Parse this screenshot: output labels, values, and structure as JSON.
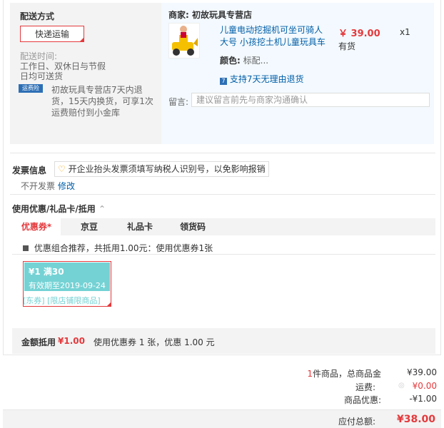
{
  "shipping": {
    "title": "配送方式",
    "method": "快递运输",
    "time_label": "配送时间:",
    "time_line1": "工作日、双休日与节假",
    "time_line2": "日均可送货",
    "insurance_badge": "运费险",
    "insurance_line1": "初故玩具专营店7天内退",
    "insurance_line2": "货，15天内换货，可享1次",
    "insurance_line3": "运费赔付到小金库"
  },
  "merchant": {
    "label": "商家:",
    "name": "初故玩具专营店",
    "product_title_line1": "儿童电动挖掘机可坐可骑人",
    "product_title_line2": "大号 小孩挖土机儿童玩具车",
    "price": "￥ 39.00",
    "quantity": "x1",
    "stock": "有货",
    "color_label": "颜色:",
    "color_value": "标配...",
    "return_policy": "支持7天无理由退货",
    "remark_label": "留言:",
    "remark_placeholder": "建议留言前先与商家沟通确认"
  },
  "invoice": {
    "title": "发票信息",
    "tip": "开企业抬头发票须填写纳税人识别号，以免影响报销",
    "status": "不开发票",
    "edit_link": "修改"
  },
  "discount": {
    "title": "使用优惠/礼品卡/抵用",
    "tabs": [
      "优惠券*",
      "京豆",
      "礼品卡",
      "领货码"
    ],
    "combo_text": "优惠组合推荐，共抵用1.00元：使用优惠券1张",
    "coupon_amount": "¥1",
    "coupon_condition": "满30",
    "coupon_expiry": "有效期至2019-09-24",
    "coupon_tags": "[东券] [限店铺限商品]",
    "summary_label": "金额抵用",
    "summary_amount": "¥1.00",
    "summary_detail": "使用优惠券 1 张，优惠 1.00 元"
  },
  "totals": {
    "count": "1",
    "count_suffix": "件商品，总商品金",
    "goods_amount": "¥39.00",
    "shipping_label": "运费:",
    "shipping_amount": "¥0.00",
    "discount_label": "商品优惠:",
    "discount_amount": "-¥1.00",
    "payable_label": "应付总额:",
    "payable_amount": "¥38.00"
  },
  "colors": {
    "accent_red": "#e4393c",
    "coupon_teal": "#74d2d4",
    "link_blue": "#005ea7",
    "shipping_orange": "#e4393c"
  }
}
